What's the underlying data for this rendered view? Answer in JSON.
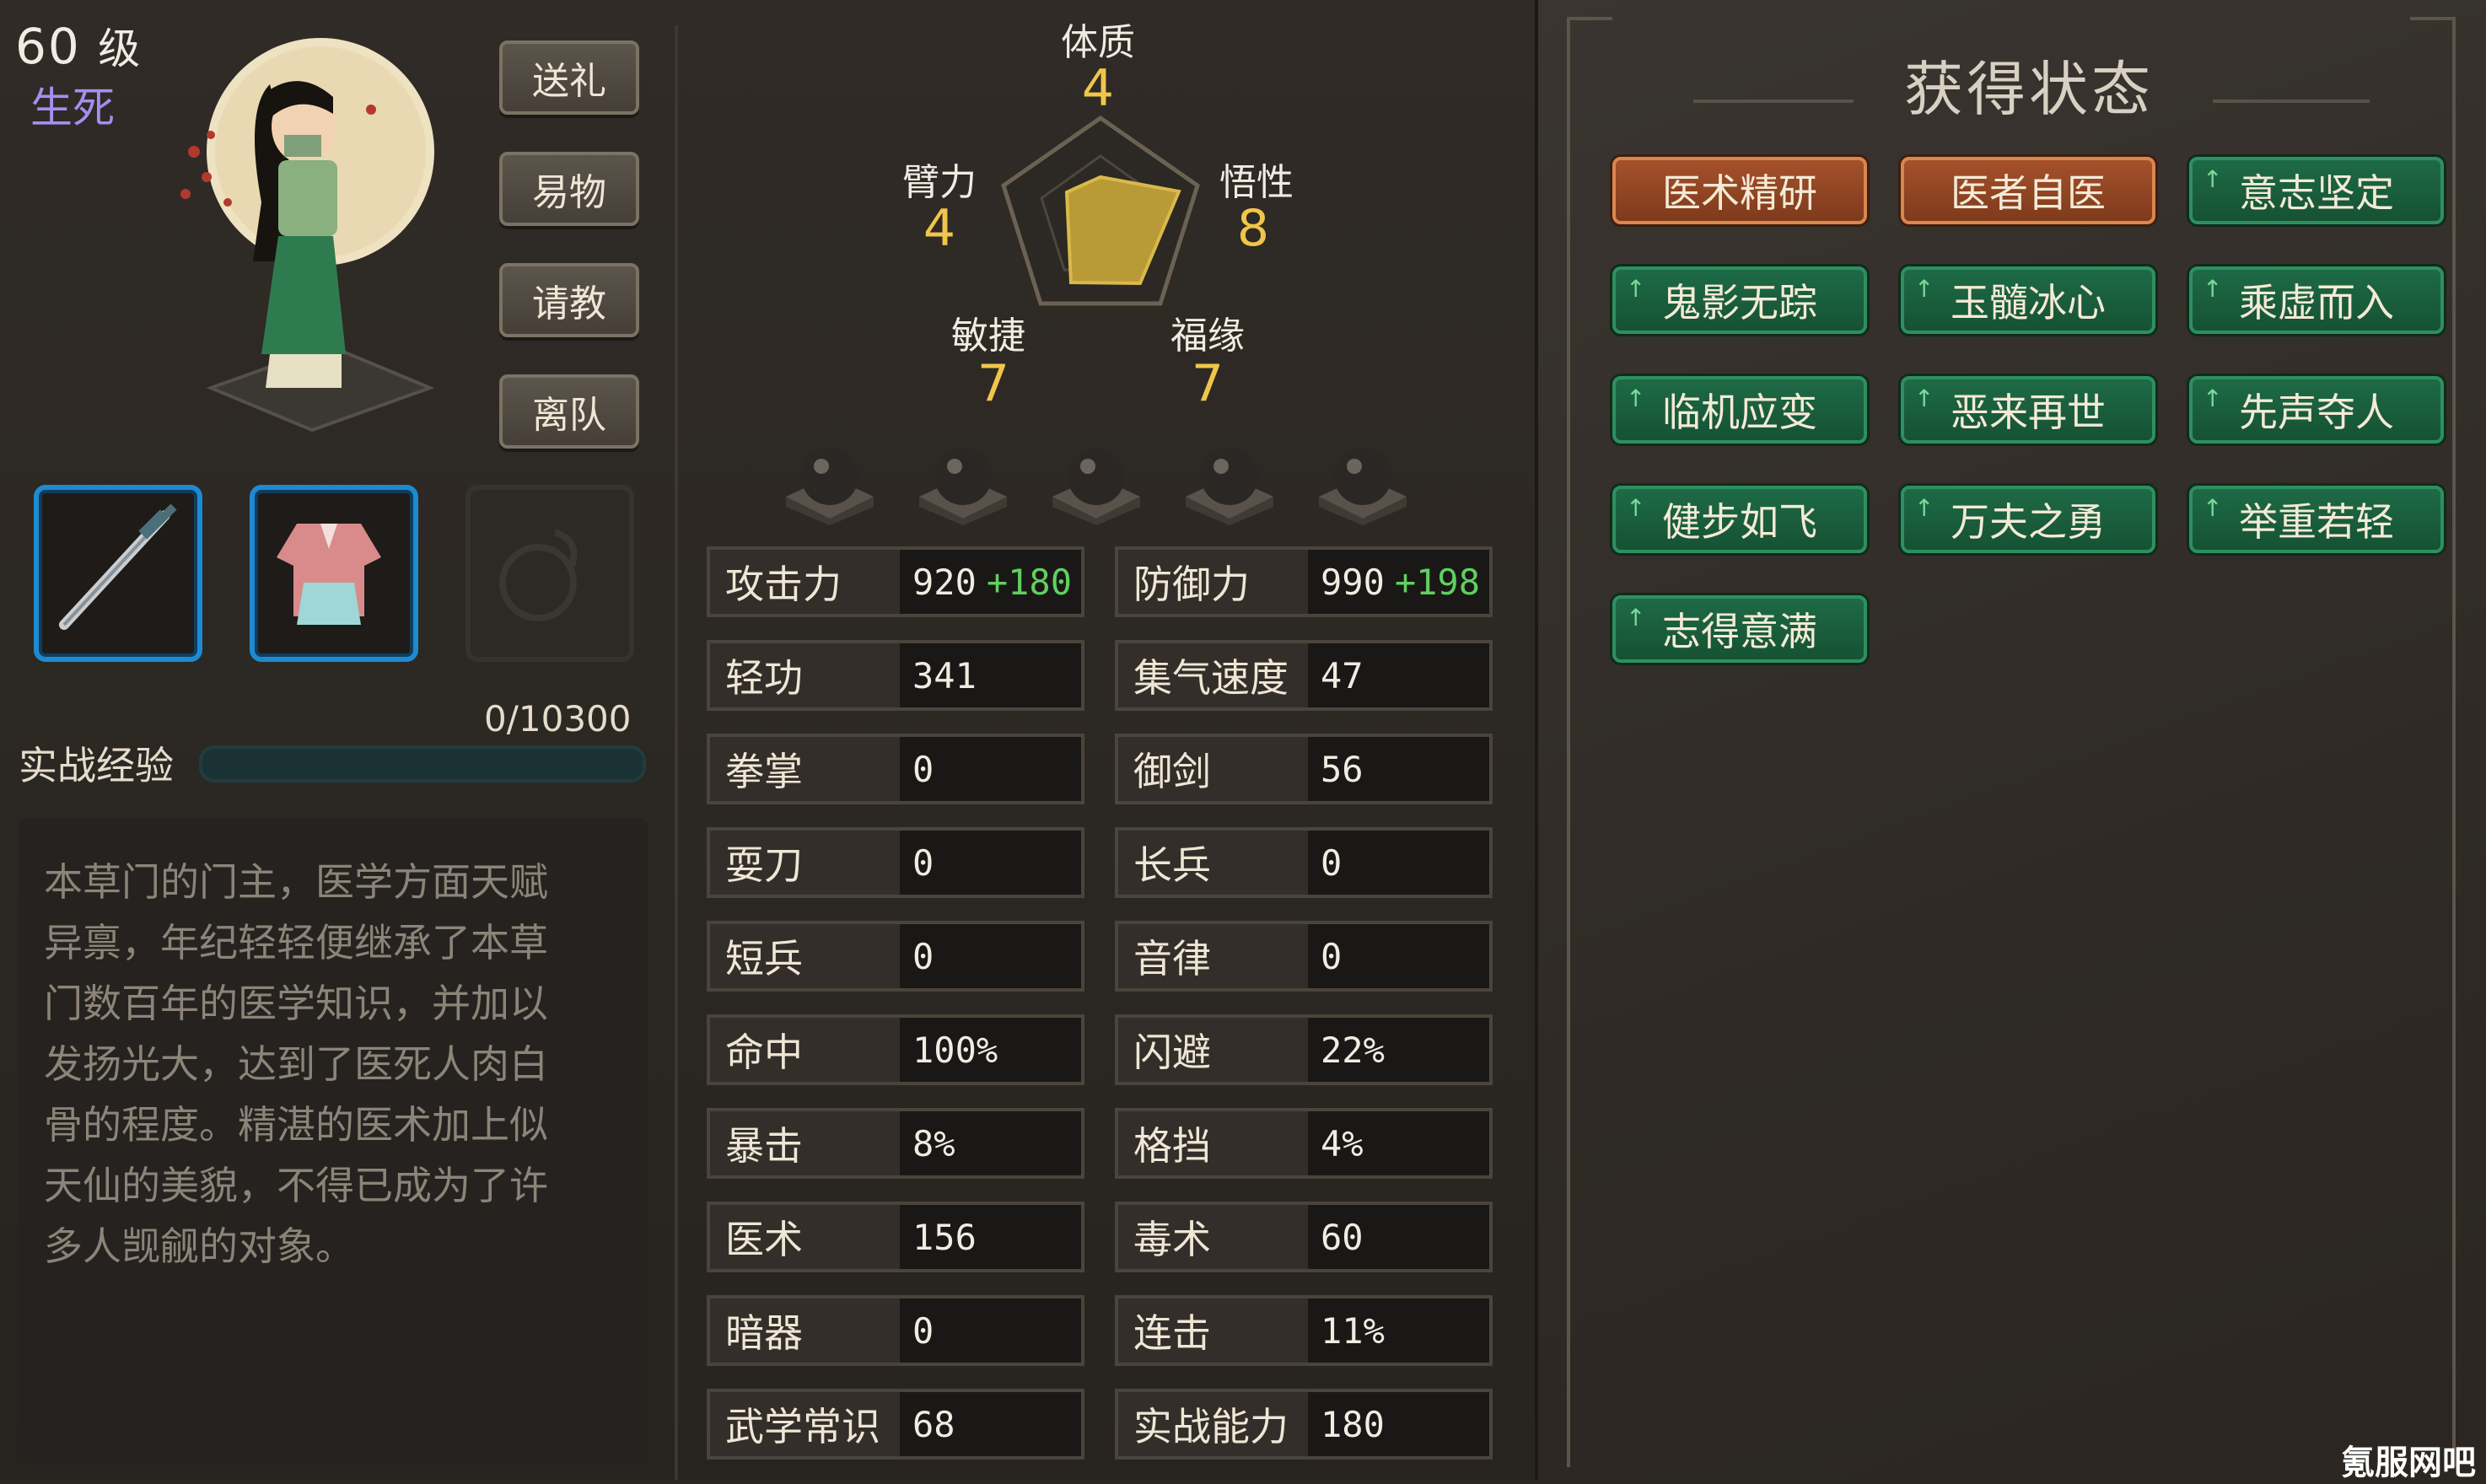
{
  "header": {
    "level_num": "60",
    "level_unit": "级",
    "fate": "生死"
  },
  "side_buttons": [
    "送礼",
    "易物",
    "请教",
    "离队"
  ],
  "equipment": [
    {
      "name": "sword-icon",
      "active": true
    },
    {
      "name": "robe-icon",
      "active": true
    },
    {
      "name": "pouch-icon",
      "active": false
    }
  ],
  "experience": {
    "label": "实战经验",
    "current": 0,
    "max": 10300,
    "value_text": "0/10300"
  },
  "description": "本草门的门主，医学方面天赋异禀，年纪轻轻便继承了本草门数百年的医学知识，并加以发扬光大，达到了医死人肉白骨的程度。精湛的医术加上似天仙的美貌，不得已成为了许多人觊觎的对象。",
  "attributes": [
    {
      "name": "体质",
      "value": "4"
    },
    {
      "name": "悟性",
      "value": "8"
    },
    {
      "name": "福缘",
      "value": "7"
    },
    {
      "name": "敏捷",
      "value": "7"
    },
    {
      "name": "臂力",
      "value": "4"
    }
  ],
  "stats": [
    {
      "label": "攻击力",
      "value": "920",
      "bonus": "+180"
    },
    {
      "label": "防御力",
      "value": "990",
      "bonus": "+198"
    },
    {
      "label": "轻功",
      "value": "341"
    },
    {
      "label": "集气速度",
      "value": "47"
    },
    {
      "label": "拳掌",
      "value": "0"
    },
    {
      "label": "御剑",
      "value": "56"
    },
    {
      "label": "耍刀",
      "value": "0"
    },
    {
      "label": "长兵",
      "value": "0"
    },
    {
      "label": "短兵",
      "value": "0"
    },
    {
      "label": "音律",
      "value": "0"
    },
    {
      "label": "命中",
      "value": "100%"
    },
    {
      "label": "闪避",
      "value": "22%"
    },
    {
      "label": "暴击",
      "value": "8%"
    },
    {
      "label": "格挡",
      "value": "4%"
    },
    {
      "label": "医术",
      "value": "156"
    },
    {
      "label": "毒术",
      "value": "60"
    },
    {
      "label": "暗器",
      "value": "0"
    },
    {
      "label": "连击",
      "value": "11%"
    },
    {
      "label": "武学常识",
      "value": "68"
    },
    {
      "label": "实战能力",
      "value": "180"
    }
  ],
  "status_panel": {
    "title": "获得状态",
    "badges": [
      {
        "label": "医术精研",
        "color": "orange",
        "arrow": false
      },
      {
        "label": "医者自医",
        "color": "orange",
        "arrow": false
      },
      {
        "label": "意志坚定",
        "color": "green",
        "arrow": true
      },
      {
        "label": "鬼影无踪",
        "color": "green",
        "arrow": true
      },
      {
        "label": "玉髓冰心",
        "color": "green",
        "arrow": true
      },
      {
        "label": "乘虚而入",
        "color": "green",
        "arrow": true
      },
      {
        "label": "临机应变",
        "color": "green",
        "arrow": true
      },
      {
        "label": "恶来再世",
        "color": "green",
        "arrow": true
      },
      {
        "label": "先声夺人",
        "color": "green",
        "arrow": true
      },
      {
        "label": "健步如飞",
        "color": "green",
        "arrow": true
      },
      {
        "label": "万夫之勇",
        "color": "green",
        "arrow": true
      },
      {
        "label": "举重若轻",
        "color": "green",
        "arrow": true
      },
      {
        "label": "志得意满",
        "color": "green",
        "arrow": true
      }
    ]
  },
  "watermark": "氪服网吧",
  "colors": {
    "gold": "#f0c64a",
    "bonus_green": "#60d060",
    "fate_purple": "#a78df0",
    "badge_orange": "#a5512b",
    "badge_green": "#1e6a46"
  }
}
